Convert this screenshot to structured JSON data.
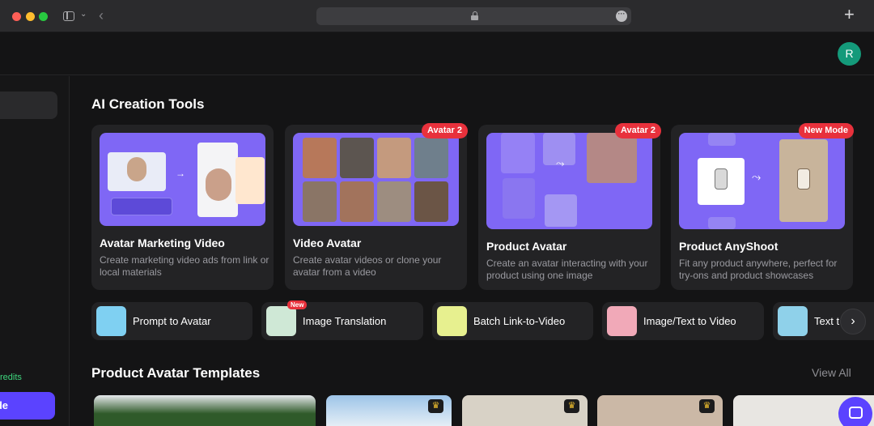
{
  "browser": {
    "back_icon": "‹",
    "plus_icon": "+"
  },
  "header": {
    "avatar_initial": "R"
  },
  "sidebar": {
    "credits_label": "redits",
    "cta_label": "de"
  },
  "main": {
    "creation_tools_title": "AI Creation Tools",
    "cards": [
      {
        "title": "Avatar Marketing Video",
        "desc": "Create marketing video ads from link or local materials",
        "badge": ""
      },
      {
        "title": "Video Avatar",
        "desc": "Create avatar videos or clone your avatar from a video",
        "badge": "Avatar 2"
      },
      {
        "title": "Product Avatar",
        "desc": "Create an avatar interacting with your product using one image",
        "badge": "Avatar 2"
      },
      {
        "title": "Product AnyShoot",
        "desc": "Fit any product anywhere, perfect for try-ons and product showcases",
        "badge": "New Mode"
      }
    ],
    "tools": [
      {
        "label": "Prompt to Avatar",
        "tag": ""
      },
      {
        "label": "Image Translation",
        "tag": "New"
      },
      {
        "label": "Batch Link-to-Video",
        "tag": ""
      },
      {
        "label": "Image/Text to Video",
        "tag": ""
      },
      {
        "label": "Text t",
        "tag": ""
      }
    ],
    "templates_title": "Product Avatar Templates",
    "view_all": "View All"
  },
  "colors": {
    "accent": "#5b43ff",
    "badge_red": "#e8313c",
    "credits_green": "#3ed67d",
    "card_bg": "#232325",
    "thumb_purple": "#7f67f5"
  }
}
